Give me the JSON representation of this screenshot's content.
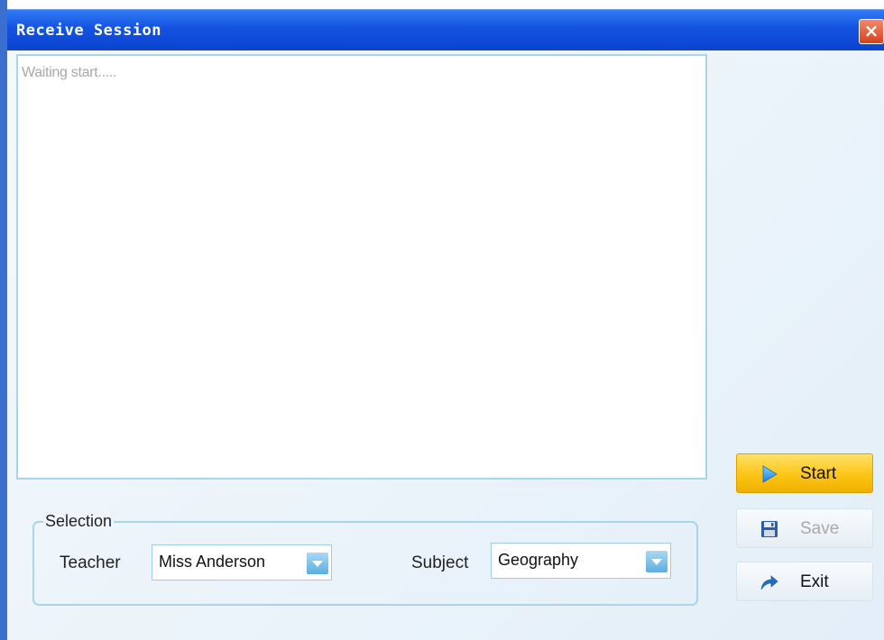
{
  "window": {
    "title": "Receive Session",
    "close_glyph": "×"
  },
  "log": {
    "text": "Waiting start....."
  },
  "selection": {
    "legend": "Selection",
    "teacher_label": "Teacher",
    "teacher_value": "Miss Anderson",
    "subject_label": "Subject",
    "subject_value": "Geography"
  },
  "buttons": {
    "start": {
      "label": "Start",
      "icon": "play-icon",
      "enabled": true
    },
    "save": {
      "label": "Save",
      "icon": "floppy-disk-icon",
      "enabled": false
    },
    "exit": {
      "label": "Exit",
      "icon": "exit-arrow-icon",
      "enabled": true
    }
  },
  "colors": {
    "titlebar": "#1452e0",
    "accent_border": "#a8d4ee",
    "start_button": "#fcc516",
    "close_button": "#d8401c"
  }
}
